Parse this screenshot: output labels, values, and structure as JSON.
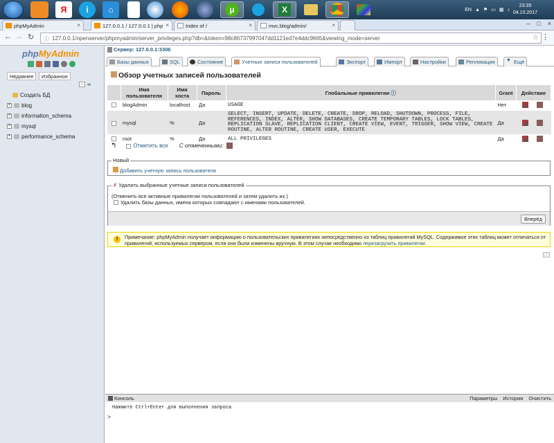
{
  "taskbar": {
    "apps": [
      {
        "icon": "start-orb-icon"
      },
      {
        "icon": "uc-browser-icon"
      },
      {
        "icon": "yandex-icon",
        "glyph": "Я"
      },
      {
        "icon": "info-icon",
        "glyph": "i"
      },
      {
        "icon": "home-icon",
        "glyph": "⌂"
      },
      {
        "icon": "document-icon"
      },
      {
        "icon": "globe-icon"
      },
      {
        "icon": "firefox-icon"
      },
      {
        "icon": "app-icon"
      },
      {
        "icon": "utorrent-icon"
      },
      {
        "icon": "skype-icon"
      },
      {
        "icon": "excel-icon",
        "glyph": "X"
      },
      {
        "icon": "folder-icon"
      },
      {
        "icon": "chrome-icon"
      },
      {
        "icon": "paint-icon"
      }
    ],
    "lang": "EN",
    "time": "23:39",
    "date": "04.10.2017"
  },
  "browser": {
    "tabs": [
      {
        "title": "phpMyAdmin"
      },
      {
        "title": "127.0.0.1 / 127.0.0.1 | php"
      },
      {
        "title": "Index of /"
      },
      {
        "title": "mvc.blog/admin/"
      }
    ],
    "url": "127.0.0.1/openserver/phpmyadmin/server_privileges.php?db=&token=98c86737997047dd1121ed7e4ddc9665&viewing_mode=server"
  },
  "nav": {
    "logo_a": "php",
    "logo_b": "MyAdmin",
    "recent": "Недавнее",
    "favorites": "Избранное",
    "create_db": "Создать БД",
    "dbs": [
      "blog",
      "information_schema",
      "mysql",
      "performance_schema"
    ]
  },
  "main": {
    "server": "Сервер: 127.0.0.1:3306",
    "tabs": [
      {
        "label": "Базы данных"
      },
      {
        "label": "SQL"
      },
      {
        "label": "Состояние"
      },
      {
        "label": "Учетные записи пользователей"
      },
      {
        "label": "Экспорт"
      },
      {
        "label": "Импорт"
      },
      {
        "label": "Настройки"
      },
      {
        "label": "Репликация"
      },
      {
        "label": "Ещё"
      }
    ],
    "title": "Обзор учетных записей пользователей",
    "table": {
      "headers": [
        "Имя пользователя",
        "Имя хоста",
        "Пароль",
        "Глобальные привилегии",
        "Grant",
        "Действие"
      ],
      "rows": [
        {
          "user": "blogAdmin",
          "host": "localhost",
          "password": "Да",
          "privs": "USAGE",
          "grant": "Нет"
        },
        {
          "user": "mysql",
          "host": "%",
          "password": "Да",
          "privs": "SELECT, INSERT, UPDATE, DELETE, CREATE, DROP, RELOAD, SHUTDOWN, PROCESS, FILE, REFERENCES, INDEX, ALTER, SHOW DATABASES, CREATE TEMPORARY TABLES, LOCK TABLES, REPLICATION SLAVE, REPLICATION CLIENT, CREATE VIEW, EVENT, TRIGGER, SHOW VIEW, CREATE ROUTINE, ALTER ROUTINE, CREATE USER, EXECUTE",
          "grant": "Да"
        },
        {
          "user": "root",
          "host": "%",
          "password": "Да",
          "privs": "ALL PRIVILEGES",
          "grant": "Да"
        }
      ],
      "check_all": "Отметить все",
      "with_selected": "С отмеченными:"
    },
    "new_legend": "Новый",
    "add_user": "Добавить учетную запись пользователя",
    "delete_legend": "Удалить выбранные учетные записи пользователей",
    "delete_hint": "(Отменить все активные привилегии пользователей и затем удалить их.)",
    "drop_db_label": "Удалить базы данных, имена которых совпадают с именами пользователей.",
    "go_button": "Вперёд",
    "notice_text": "Примечание: phpMyAdmin получает информацию о пользовательских привилегиях непосредственно из таблиц привилегий MySQL. Содержимое этих таблиц может отличаться от привилегий, используемых сервером, если они были изменены вручную. В этом случае необходимо",
    "notice_link": "перезагрузить привилегии",
    "console": {
      "title": "Консоль",
      "params": "Параметры",
      "history": "История",
      "clear": "Очистить",
      "hint": "Нажмите Ctrl+Enter для выполнения запроса",
      "prompt": ">"
    }
  }
}
